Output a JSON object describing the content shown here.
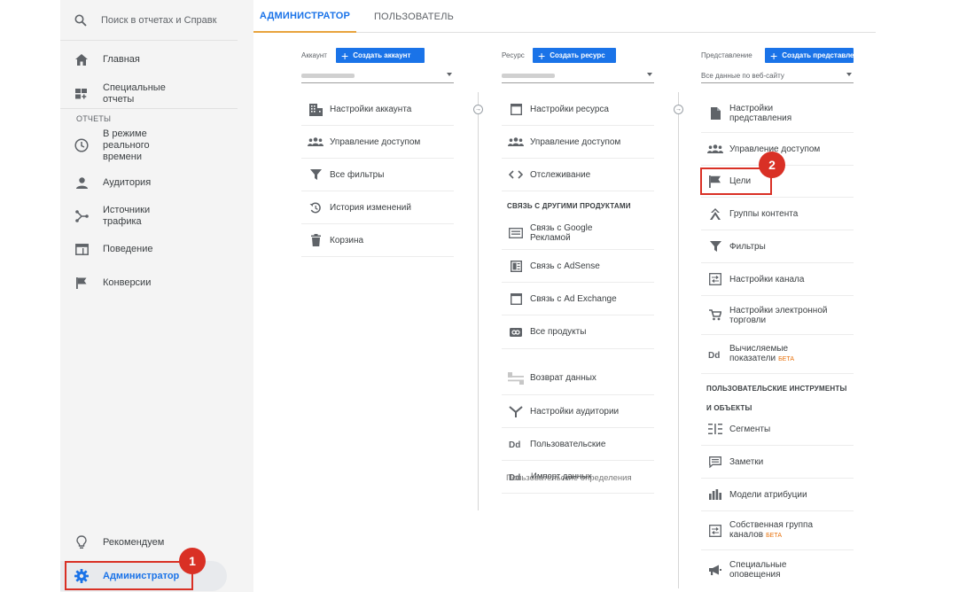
{
  "sidebar": {
    "search_placeholder": "Поиск в отчетах и Справк",
    "items": [
      {
        "label": "Главная"
      },
      {
        "label": "Специальные отчеты"
      },
      {
        "label": "В режиме реального времени"
      },
      {
        "label": "Аудитория"
      },
      {
        "label": "Источники трафика"
      },
      {
        "label": "Поведение"
      },
      {
        "label": "Конверсии"
      }
    ],
    "reports_caption": "ОТЧЕТЫ",
    "recommend_label": "Рекомендуем",
    "admin_label": "Администратор",
    "badge_1": "1"
  },
  "tabs": {
    "admin": "АДМИНИСТРАТОР",
    "user": "ПОЛЬЗОВАТЕЛЬ"
  },
  "account": {
    "label": "Аккаунт",
    "create_button": "Создать аккаунт",
    "items": [
      {
        "label": "Настройки аккаунта",
        "icon": "building-icon"
      },
      {
        "label": "Управление доступом",
        "icon": "people-icon"
      },
      {
        "label": "Все фильтры",
        "icon": "filter-icon"
      },
      {
        "label": "История изменений",
        "icon": "history-icon"
      },
      {
        "label": "Корзина",
        "icon": "trash-icon"
      }
    ]
  },
  "property": {
    "label": "Ресурс",
    "create_button": "Создать ресурс",
    "items": [
      {
        "label": "Настройки ресурса",
        "icon": "window-icon"
      },
      {
        "label": "Управление доступом",
        "icon": "people-icon"
      },
      {
        "label": "Отслеживание",
        "icon": "code-icon"
      }
    ],
    "linking_title": "СВЯЗЬ С ДРУГИМИ ПРОДУКТАМИ",
    "linking": [
      {
        "label": "Связь с Google Рекламой",
        "icon": "ads-icon"
      },
      {
        "label": "Связь с AdSense",
        "icon": "adsense-icon"
      },
      {
        "label": "Связь с Ad Exchange",
        "icon": "adx-icon"
      },
      {
        "label": "Все продукты",
        "icon": "link-icon"
      }
    ],
    "more": [
      {
        "label": "Возврат данных",
        "icon": "data-return-icon"
      },
      {
        "label": "Настройки аудитории",
        "icon": "audience-icon"
      },
      {
        "label": "Пользовательские",
        "icon": "dd-icon"
      }
    ],
    "overlap_a": "Пользовательские определения",
    "overlap_b": "Импорт данных"
  },
  "view": {
    "label": "Представление",
    "create_button": "Создать представление",
    "dropdown": "Все данные по веб-сайту",
    "items": [
      {
        "label": "Настройки представления",
        "icon": "doc-icon"
      },
      {
        "label": "Управление доступом",
        "icon": "people-icon"
      },
      {
        "label": "Цели",
        "icon": "flag-icon"
      },
      {
        "label": "Группы контента",
        "icon": "content-group-icon"
      },
      {
        "label": "Фильтры",
        "icon": "filter-icon"
      },
      {
        "label": "Настройки канала",
        "icon": "channel-icon"
      },
      {
        "label": "Настройки электронной торговли",
        "icon": "cart-icon"
      },
      {
        "label": "Вычисляемые показатели",
        "icon": "dd-icon",
        "beta": "БЕТА"
      }
    ],
    "tools_title_1": "ПОЛЬЗОВАТЕЛЬСКИЕ ИНСТРУМЕНТЫ",
    "tools_title_2": "И ОБЪЕКТЫ",
    "tools": [
      {
        "label": "Сегменты",
        "icon": "segments-icon"
      },
      {
        "label": "Заметки",
        "icon": "notes-icon"
      },
      {
        "label": "Модели атрибуции",
        "icon": "bars-icon"
      },
      {
        "label": "Собственная группа каналов",
        "icon": "channel-icon",
        "beta": "БЕТА"
      },
      {
        "label": "Специальные оповещения",
        "icon": "megaphone-icon"
      }
    ],
    "badge_2": "2"
  }
}
